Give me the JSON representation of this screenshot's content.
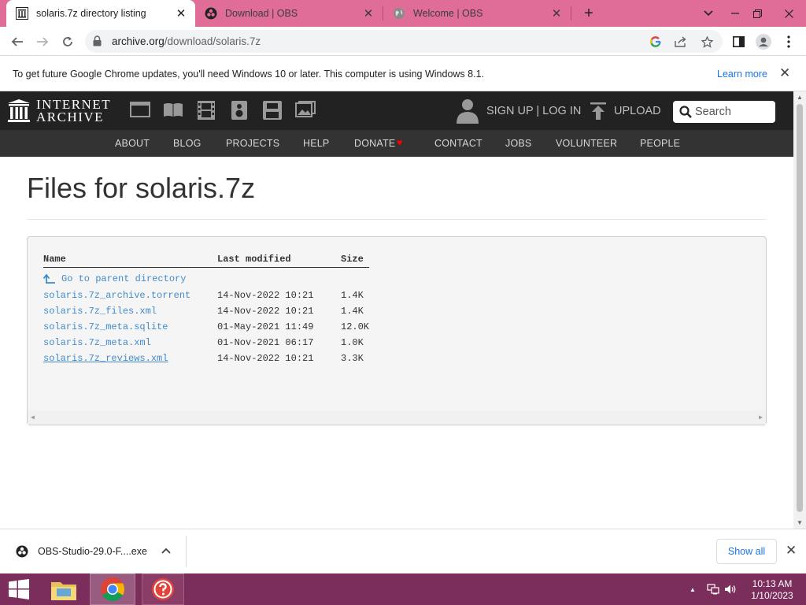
{
  "browser": {
    "tabs": [
      {
        "title": "solaris.7z directory listing",
        "active": true
      },
      {
        "title": "Download | OBS",
        "active": false
      },
      {
        "title": "Welcome | OBS",
        "active": false
      }
    ],
    "url_host": "archive.org",
    "url_path": "/download/solaris.7z"
  },
  "infobar": {
    "message": "To get future Google Chrome updates, you'll need Windows 10 or later. This computer is using Windows 8.1.",
    "learn_more": "Learn more"
  },
  "ia": {
    "logo_line1": "INTERNET",
    "logo_line2": "ARCHIVE",
    "signup": "SIGN UP | LOG IN",
    "upload": "UPLOAD",
    "search_placeholder": "Search",
    "nav": [
      "ABOUT",
      "BLOG",
      "PROJECTS",
      "HELP",
      "DONATE",
      "CONTACT",
      "JOBS",
      "VOLUNTEER",
      "PEOPLE"
    ],
    "donate_heart_color": "#ff0000"
  },
  "page": {
    "title": "Files for solaris.7z",
    "columns": {
      "name": "Name",
      "modified": "Last modified",
      "size": "Size"
    },
    "parent_link": "Go to parent directory",
    "files": [
      {
        "name": "solaris.7z_archive.torrent",
        "modified": "14-Nov-2022 10:21",
        "size": "1.4K"
      },
      {
        "name": "solaris.7z_files.xml",
        "modified": "14-Nov-2022 10:21",
        "size": "1.4K"
      },
      {
        "name": "solaris.7z_meta.sqlite",
        "modified": "01-May-2021 11:49",
        "size": "12.0K"
      },
      {
        "name": "solaris.7z_meta.xml",
        "modified": "01-Nov-2021 06:17",
        "size": "1.0K"
      },
      {
        "name": "solaris.7z_reviews.xml",
        "modified": "14-Nov-2022 10:21",
        "size": "3.3K"
      }
    ]
  },
  "downloads": {
    "file": "OBS-Studio-29.0-F....exe",
    "show_all": "Show all"
  },
  "taskbar": {
    "time": "10:13 AM",
    "date": "1/10/2023"
  },
  "colors": {
    "tabstrip": "#e06c98",
    "taskbar": "#7b2d5c",
    "link": "#428bca"
  }
}
